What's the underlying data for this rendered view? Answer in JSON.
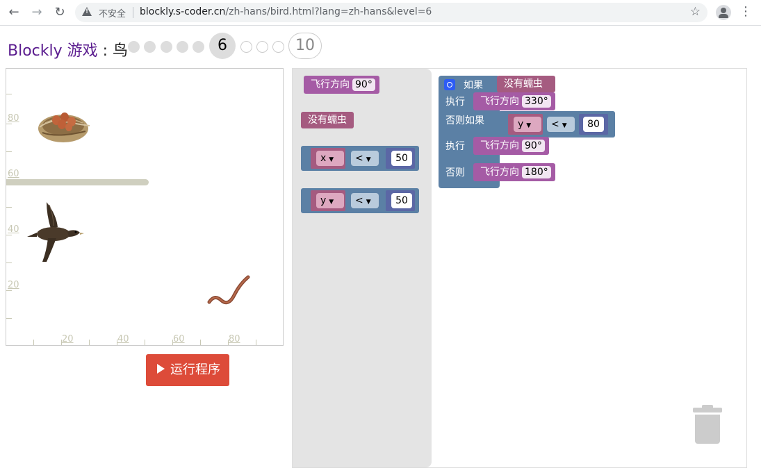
{
  "browser": {
    "insecure_label": "不安全",
    "url_host": "blockly.s-coder.cn",
    "url_rest": "/zh-hans/bird.html?lang=zh-hans&level=6"
  },
  "header": {
    "app_name": "Blockly 游戏",
    "separator": " : ",
    "game_name": "鸟",
    "current_level": "6",
    "last_level": "10"
  },
  "stage": {
    "y_labels": [
      "80",
      "60",
      "40",
      "20"
    ],
    "x_labels": [
      "20",
      "40",
      "60",
      "80"
    ]
  },
  "run_button": {
    "label": "运行程序"
  },
  "toolbox": {
    "fly_label": "飞行方向",
    "fly_value": "90°",
    "no_worm_label": "没有蠕虫",
    "cmp_x": {
      "var": "x",
      "op": "<",
      "value": "50"
    },
    "cmp_y": {
      "var": "y",
      "op": "<",
      "value": "50"
    }
  },
  "program": {
    "if_label": "如果",
    "if_condition": "没有蠕虫",
    "do_label": "执行",
    "do1_fly_label": "飞行方向",
    "do1_fly_value": "330°",
    "elseif_label": "否则如果",
    "elseif_cmp": {
      "var": "y",
      "op": "<",
      "value": "80"
    },
    "do2_label": "执行",
    "do2_fly_label": "飞行方向",
    "do2_fly_value": "90°",
    "else_label": "否则",
    "else_fly_label": "飞行方向",
    "else_fly_value": "180°"
  }
}
